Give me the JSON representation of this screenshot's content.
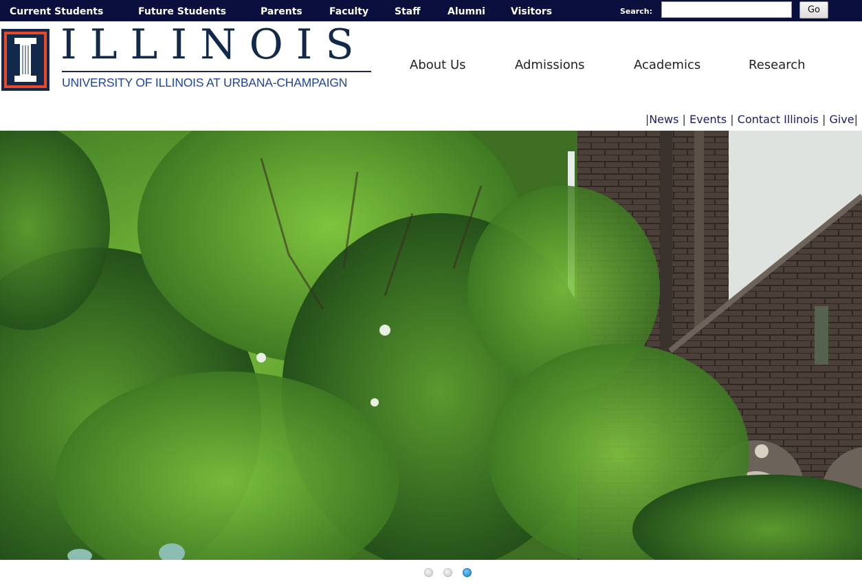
{
  "audience_nav": [
    "Current Students",
    "Future Students",
    "Parents",
    "Faculty",
    "Staff",
    "Alumni",
    "Visitors"
  ],
  "search": {
    "label": "Search:",
    "value": "",
    "placeholder": "",
    "button": "Go"
  },
  "logo": {
    "wordmark": "ILLINOIS",
    "subtitle": "UNIVERSITY OF ILLINOIS AT URBANA-CHAMPAIGN",
    "colors": {
      "navy": "#13294b",
      "orange": "#e84a27",
      "blue": "#1f4696"
    }
  },
  "main_nav": [
    "About Us",
    "Admissions",
    "Academics",
    "Research"
  ],
  "utility_nav": [
    "News",
    "Events",
    "Contact Illinois",
    "Give"
  ],
  "slideshow": {
    "slide_count": 3,
    "active_index": 3
  },
  "colors": {
    "top_bar": "#0b0f3d",
    "dot_active": "#1582cf",
    "dot_inactive": "#cccccc"
  }
}
